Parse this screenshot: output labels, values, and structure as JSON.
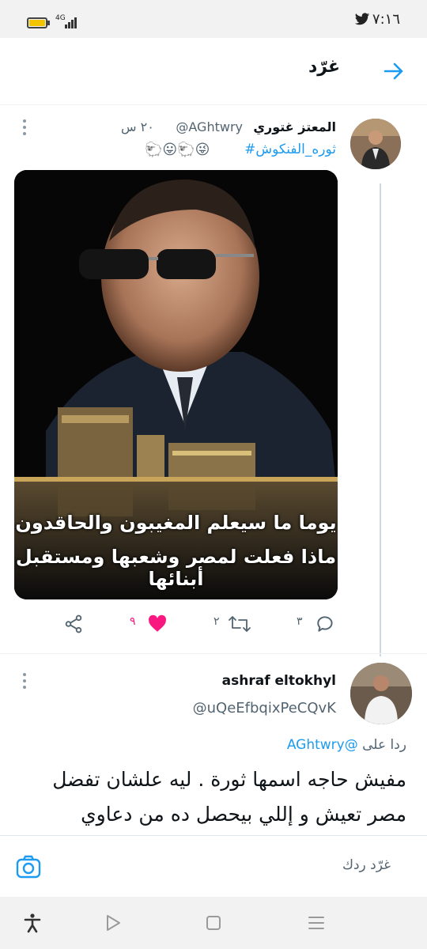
{
  "status_bar": {
    "time": "٧:١٦",
    "network": "4G"
  },
  "header": {
    "title": "غرّد"
  },
  "tweet": {
    "author_name": "المعتز غتوري",
    "handle": "@AGhtwry",
    "time": "٢٠ س",
    "hashtag": "#ثوره_الفنكوش",
    "emojis": "🐑😛🐑😜",
    "image": {
      "caption_line1": "يوما ما سيعلم المغيبون والحاقدون",
      "caption_line2": "ماذا فعلت لمصر وشعبها ومستقبل أبنائها"
    },
    "actions": {
      "reply_count": "٣",
      "retweet_count": "٢",
      "like_count": "٩"
    }
  },
  "reply": {
    "author_name": "ashraf eltokhyl",
    "handle": "@uQeEfbqixPeCQvK",
    "replying_to_label": "ردا على",
    "replying_to_handle": "@AGhtwry",
    "text": "مفيش حاجه اسمها ثورة . ليه علشان تفضل مصر تعيش و إللي بيحصل ده من دعاوي"
  },
  "compose": {
    "placeholder": "غرّد ردك"
  },
  "colors": {
    "accent": "#1d9bf0",
    "like": "#f91880",
    "text_secondary": "#536471"
  },
  "icons": [
    "twitter-icon",
    "battery-icon",
    "signal-icon",
    "back-arrow-icon",
    "more-icon",
    "reply-icon",
    "retweet-icon",
    "like-icon",
    "share-icon",
    "camera-icon",
    "accessibility-icon",
    "nav-back-icon",
    "nav-home-icon",
    "nav-menu-icon"
  ]
}
